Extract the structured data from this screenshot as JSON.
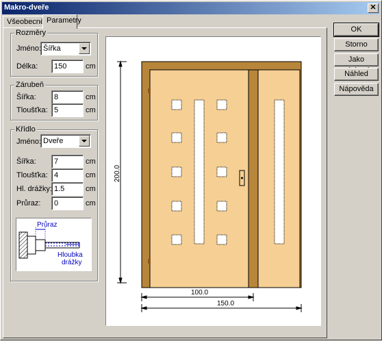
{
  "window": {
    "title": "Makro-dveře"
  },
  "tabs": [
    {
      "label": "Všeobecně"
    },
    {
      "label": "Parametry"
    }
  ],
  "rozmery": {
    "title": "Rozměry",
    "jmeno_label": "Jméno:",
    "jmeno_value": "Šířka",
    "delka_label": "Délka:",
    "delka_value": "150",
    "delka_unit": "cm"
  },
  "zarubne": {
    "title": "Zárubeň",
    "sirka_label": "Šířka:",
    "sirka_value": "8",
    "sirka_unit": "cm",
    "tloustka_label": "Tloušťka:",
    "tloustka_value": "5",
    "tloustka_unit": "cm"
  },
  "kridlo": {
    "title": "Křídlo",
    "jmeno_label": "Jméno:",
    "jmeno_value": "Dveře",
    "sirka_label": "Šířka:",
    "sirka_value": "7",
    "sirka_unit": "cm",
    "tloustka_label": "Tloušťka:",
    "tloustka_value": "4",
    "tloustka_unit": "cm",
    "hl_drazky_label": "Hl. drážky:",
    "hl_drazky_value": "1.5",
    "hl_drazky_unit": "cm",
    "pruraz_label": "Průraz:",
    "pruraz_value": "0",
    "pruraz_unit": "cm",
    "schema_label_pruraz": "Průraz",
    "schema_label_hloubka_1": "Hloubka",
    "schema_label_hloubka_2": "drážky"
  },
  "buttons": {
    "ok": "OK",
    "storno": "Storno",
    "jako_vychozi": "Jako výchozí",
    "nahled": "Náhled",
    "napoveda": "Nápověda"
  },
  "preview": {
    "height_dim": "200.0",
    "leaf_width_dim": "100.0",
    "total_width_dim": "150.0"
  },
  "colors": {
    "titlebar_start": "#0a246a",
    "titlebar_end": "#a6caf0",
    "frame_wood": "#b8863b",
    "panel_wood": "#f6cf94",
    "dimension_text_blue": "#0000c0"
  }
}
